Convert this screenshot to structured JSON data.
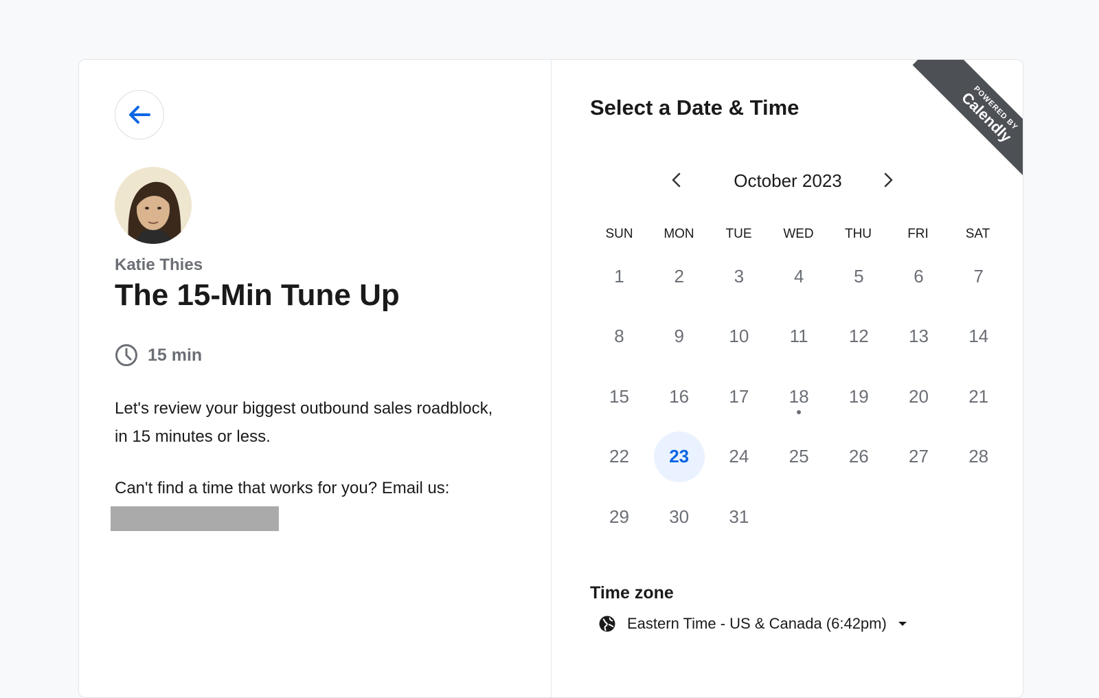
{
  "left": {
    "back_icon": "arrow-left-icon",
    "host_name": "Katie Thies",
    "event_title": "The 15-Min Tune Up",
    "duration_icon": "clock-icon",
    "duration": "15 min",
    "description": "Let's review your biggest outbound sales roadblock, in 15 minutes or less.",
    "contact_text": "Can't find a time that works for you? Email us:"
  },
  "right": {
    "section_title": "Select a Date & Time",
    "ribbon": {
      "small": "POWERED BY",
      "brand": "Calendly"
    },
    "month_label": "October 2023",
    "weekdays": [
      "SUN",
      "MON",
      "TUE",
      "WED",
      "THU",
      "FRI",
      "SAT"
    ],
    "days": [
      "1",
      "2",
      "3",
      "4",
      "5",
      "6",
      "7",
      "8",
      "9",
      "10",
      "11",
      "12",
      "13",
      "14",
      "15",
      "16",
      "17",
      "18",
      "19",
      "20",
      "21",
      "22",
      "23",
      "24",
      "25",
      "26",
      "27",
      "28",
      "29",
      "30",
      "31"
    ],
    "selected_day": "23",
    "today_marker_day": "18",
    "timezone_title": "Time zone",
    "timezone_value": "Eastern Time - US & Canada (6:42pm)"
  },
  "colors": {
    "accent": "#0b66e4",
    "selected_bg": "#eaf2ff",
    "ribbon": "#4d5055",
    "muted_text": "#6b6f75"
  }
}
